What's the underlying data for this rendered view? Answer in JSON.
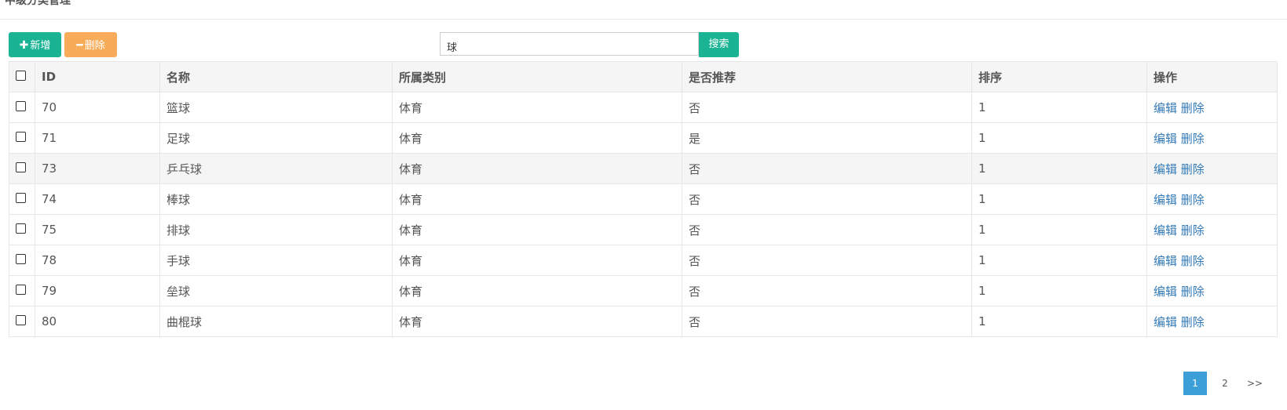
{
  "page": {
    "title": "中级分类管理"
  },
  "toolbar": {
    "add_label": "新增",
    "delete_label": "删除"
  },
  "search": {
    "value": "球",
    "button_label": "搜索"
  },
  "table": {
    "headers": [
      "ID",
      "名称",
      "所属类别",
      "是否推荐",
      "排序",
      "操作"
    ],
    "rows": [
      {
        "id": "70",
        "name": "篮球",
        "category": "体育",
        "recommended": "否",
        "order": "1"
      },
      {
        "id": "71",
        "name": "足球",
        "category": "体育",
        "recommended": "是",
        "order": "1"
      },
      {
        "id": "73",
        "name": "乒乓球",
        "category": "体育",
        "recommended": "否",
        "order": "1"
      },
      {
        "id": "74",
        "name": "棒球",
        "category": "体育",
        "recommended": "否",
        "order": "1"
      },
      {
        "id": "75",
        "name": "排球",
        "category": "体育",
        "recommended": "否",
        "order": "1"
      },
      {
        "id": "78",
        "name": "手球",
        "category": "体育",
        "recommended": "否",
        "order": "1"
      },
      {
        "id": "79",
        "name": "垒球",
        "category": "体育",
        "recommended": "否",
        "order": "1"
      },
      {
        "id": "80",
        "name": "曲棍球",
        "category": "体育",
        "recommended": "否",
        "order": "1"
      }
    ],
    "edit_label": "编辑",
    "delete_label": "删除"
  },
  "pagination": {
    "pages": [
      "1",
      "2"
    ],
    "current": "1",
    "next_label": ">>"
  },
  "colors": {
    "primary": "#1ab394",
    "warning": "#f8ac59",
    "link": "#337ab7",
    "active_page": "#3c9fd8"
  },
  "icons": {
    "add": "plus-icon",
    "delete": "minus-icon"
  }
}
